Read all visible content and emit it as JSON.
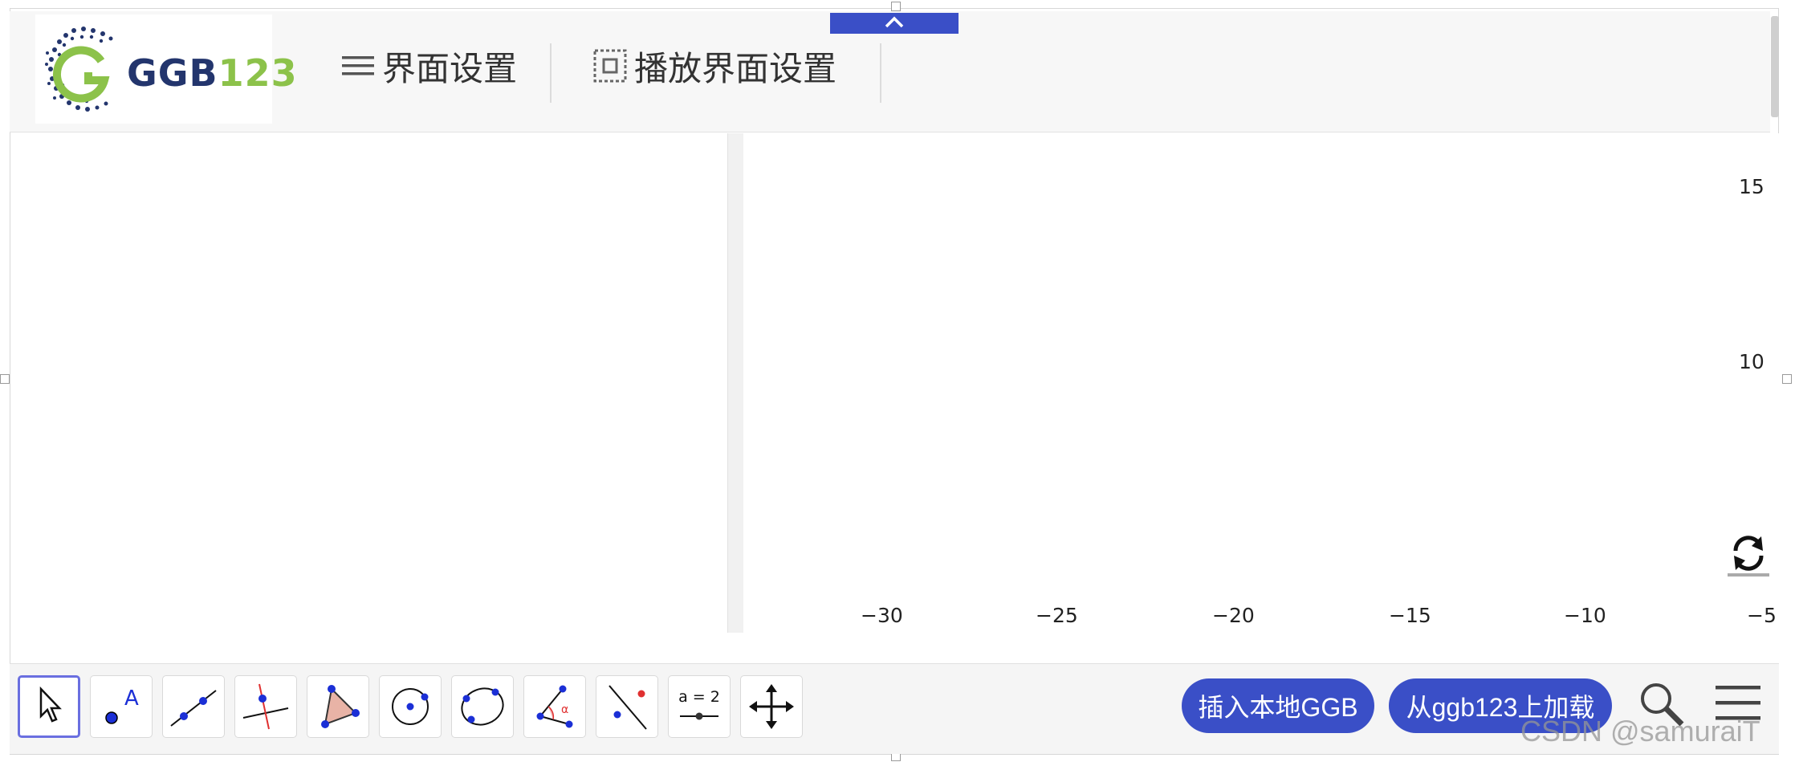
{
  "header": {
    "logo_text_a": "GGB",
    "logo_text_b": "123",
    "menu_settings_label": "界面设置",
    "playback_settings_label": "播放界面设置"
  },
  "graphics": {
    "x_ticks": [
      "−30",
      "−25",
      "−20",
      "−15",
      "−10",
      "−5"
    ],
    "y_ticks": [
      "15",
      "10"
    ]
  },
  "toolbar": {
    "tools": [
      {
        "name": "move-tool",
        "label": ""
      },
      {
        "name": "point-tool",
        "label": "A"
      },
      {
        "name": "line-tool",
        "label": ""
      },
      {
        "name": "perpendicular-line-tool",
        "label": ""
      },
      {
        "name": "polygon-tool",
        "label": ""
      },
      {
        "name": "circle-center-point-tool",
        "label": ""
      },
      {
        "name": "circle-three-points-tool",
        "label": ""
      },
      {
        "name": "angle-tool",
        "label": "α"
      },
      {
        "name": "reflect-tool",
        "label": ""
      },
      {
        "name": "slider-tool",
        "label": "a = 2"
      },
      {
        "name": "move-graphics-view-tool",
        "label": ""
      }
    ],
    "insert_local_label": "插入本地GGB",
    "load_from_label": "从ggb123上加载"
  },
  "watermark": "CSDN @samuraiT",
  "colors": {
    "accent": "#3a4fc7",
    "logo_dark": "#23356d",
    "logo_green": "#8cc24a"
  }
}
